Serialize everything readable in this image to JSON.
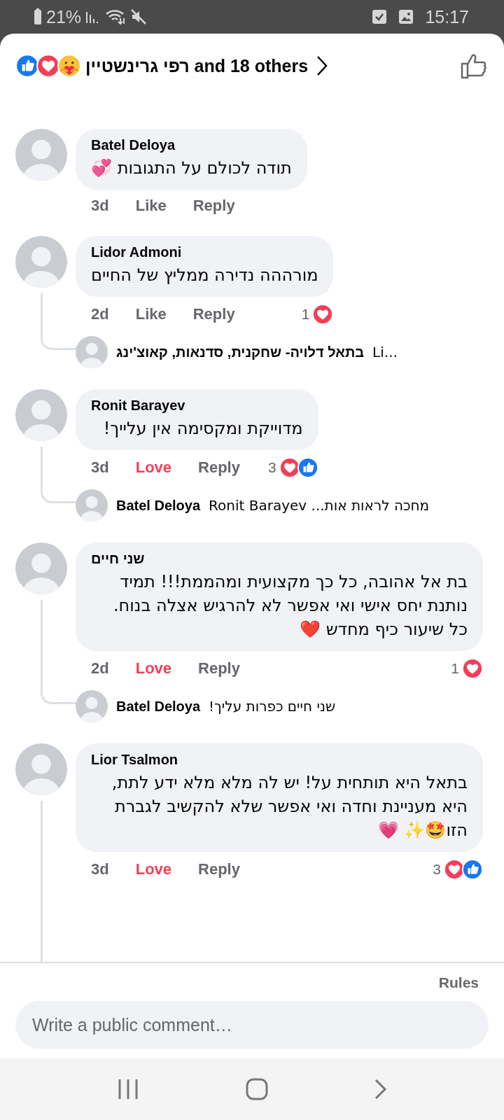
{
  "status_bar": {
    "battery": "21%",
    "time": "15:17"
  },
  "header": {
    "reactions": [
      {
        "kind": "like"
      },
      {
        "kind": "love"
      },
      {
        "kind": "care"
      }
    ],
    "summary": "רפי גרינשטיין and 18 others"
  },
  "comments": [
    {
      "author": "Batel Deloya",
      "text": "תודה לכולם על התגובות 💞",
      "time": "3d",
      "reaction_label": "Like",
      "reacted": false,
      "reply_label": "Reply"
    },
    {
      "author": "Lidor Admoni",
      "text": "מורההה נדירה ממליץ של החיים",
      "time": "2d",
      "reaction_label": "Like",
      "reacted": false,
      "reply_label": "Reply",
      "reactions": {
        "count": "1",
        "icons": [
          {
            "kind": "love"
          }
        ]
      },
      "replies": [
        {
          "author": "בתאל דלויה- שחקנית, סדנאות, קאוצ'ינג",
          "text": "Li..."
        }
      ]
    },
    {
      "author": "Ronit Barayev",
      "text": "מדוייקת ומקסימה אין עלייך!",
      "time": "3d",
      "reaction_label": "Love",
      "reacted": true,
      "reply_label": "Reply",
      "reactions": {
        "count": "3",
        "icons": [
          {
            "kind": "love"
          },
          {
            "kind": "like"
          }
        ]
      },
      "replies": [
        {
          "author": "Batel Deloya",
          "text": "מחכה לראות אות... Ronit Barayev"
        }
      ]
    },
    {
      "author": "שני חיים",
      "text": "בת אל אהובה, כל כך מקצועית ומהממת!!! תמיד נותנת יחס אישי ואי אפשר לא להרגיש אצלה בנוח. כל שיעור כיף מחדש ❤️",
      "time": "2d",
      "reaction_label": "Love",
      "reacted": true,
      "reply_label": "Reply",
      "reactions": {
        "count": "1",
        "icons": [
          {
            "kind": "love"
          }
        ]
      },
      "replies": [
        {
          "author": "Batel Deloya",
          "text": "שני חיים כפרות עליך!"
        }
      ]
    },
    {
      "author": "Lior Tsalmon",
      "text": "בתאל היא תותחית על! יש לה מלא מלא ידע לתת, היא מעניינת וחדה ואי אפשר שלא להקשיב לגברת הזו🤩✨ 💗",
      "time": "3d",
      "reaction_label": "Love",
      "reacted": true,
      "reply_label": "Reply",
      "reactions": {
        "count": "3",
        "icons": [
          {
            "kind": "love"
          },
          {
            "kind": "like"
          }
        ]
      },
      "more_replies": true
    }
  ],
  "footer": {
    "rules": "Rules",
    "comment_field": {
      "placeholder": "Write a public comment…"
    }
  }
}
